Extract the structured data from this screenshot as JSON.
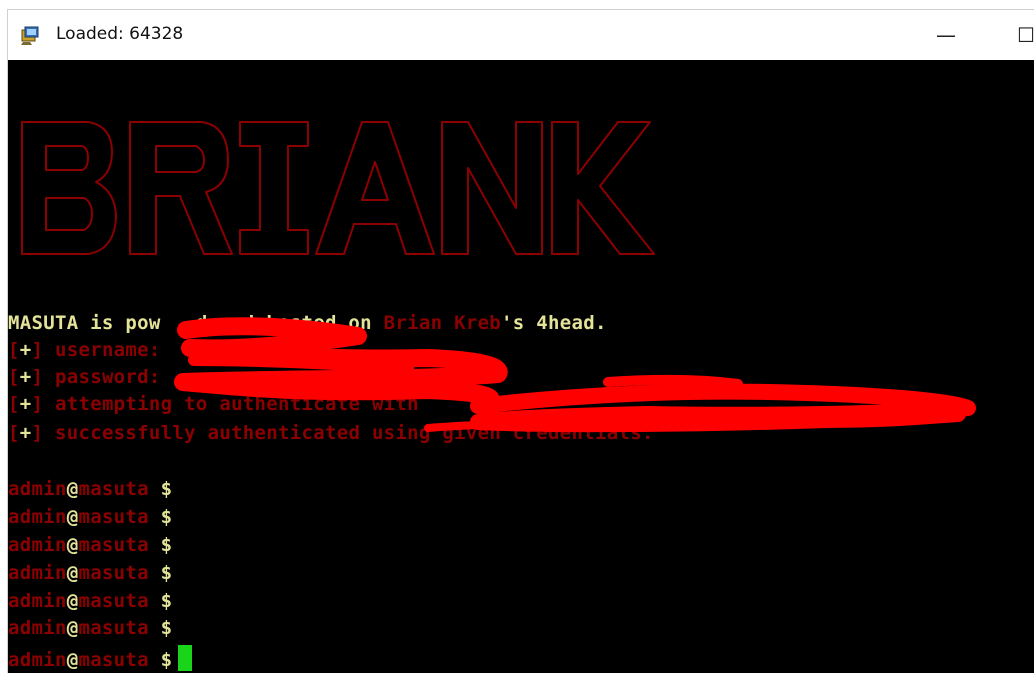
{
  "window": {
    "title": "Loaded: 64328",
    "icon": "terminal-app-icon",
    "controls": {
      "minimize": "—",
      "maximize": "☐"
    }
  },
  "banner": {
    "text": "BRIANK",
    "color": "#8b0000"
  },
  "terminal": {
    "intro": {
      "pre": "MASUTA is pow",
      "post": "d and hosted on ",
      "highlight": "Brian Kreb",
      "tail": "'s 4head."
    },
    "log": [
      {
        "open": "[",
        "mark": "+",
        "close": "]",
        "text": " username:"
      },
      {
        "open": "[",
        "mark": "+",
        "close": "]",
        "text": " password:"
      },
      {
        "open": "[",
        "mark": "+",
        "close": "]",
        "text": " attempting to authenticate with"
      },
      {
        "open": "[",
        "mark": "+",
        "close": "]",
        "text": " successfully authenticated using given credentials."
      }
    ],
    "prompt": {
      "user": "admin",
      "at": "@",
      "host": "masuta",
      "symbol": " $"
    },
    "prompt_count": 7
  },
  "colors": {
    "background": "#000000",
    "text_yellow": "#e3e39a",
    "text_red": "#8b0000",
    "cursor": "#19d419",
    "redaction": "#ff0000"
  }
}
